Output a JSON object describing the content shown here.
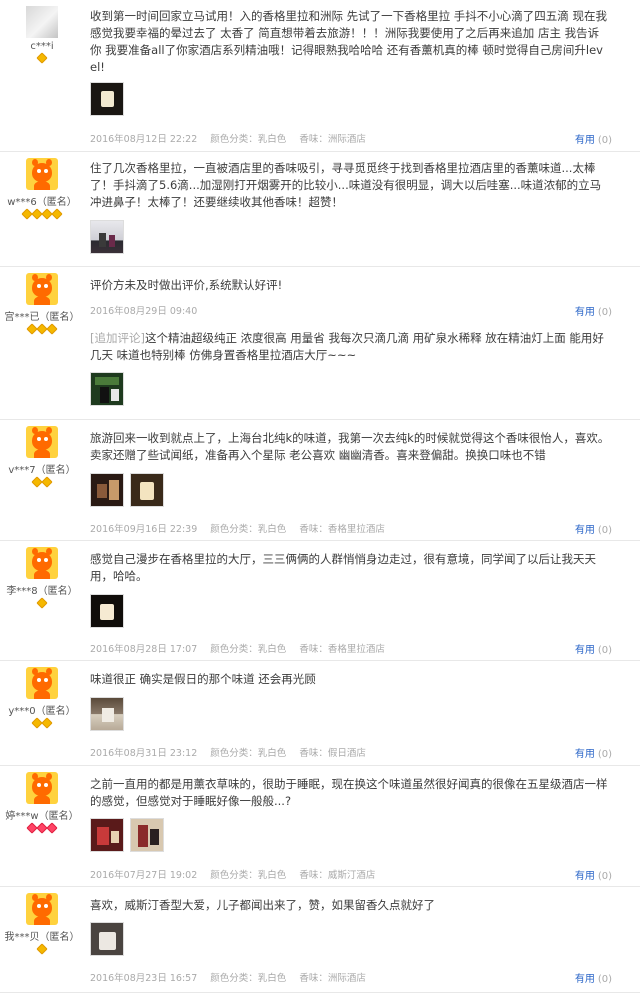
{
  "reviews": [
    {
      "user": "c***i",
      "badges": [
        "gold"
      ],
      "avatar": "gray",
      "content": "收到第一时间回家立马试用！入的香格里拉和洲际 先试了一下香格里拉 手抖不小心滴了四五滴 现在我感觉我要幸福的晕过去了 太香了 简直想带着去旅游！！！洲际我要使用了之后再来追加 店主 我告诉你 我要准备all了你家酒店系列精油哦！记得眼熟我哈哈哈 还有香薰机真的棒 顿时觉得自己房间升level!",
      "images": [
        "candle"
      ],
      "date": "2016年08月12日 22:22",
      "color_label": "颜色分类：乳白色",
      "scent_label": "香味：洲际酒店",
      "useful_label": "有用",
      "useful_count": "(0)"
    },
    {
      "user": "w***6（匿名）",
      "badges": [
        "gold",
        "gold",
        "gold",
        "gold"
      ],
      "avatar": "taobao",
      "content": "住了几次香格里拉，一直被酒店里的香味吸引，寻寻觅觅终于找到香格里拉酒店里的香薰味道...太棒了！手抖滴了5.6滴...加湿刚打开烟雾开的比较小...味道没有很明显，调大以后哇塞...味道浓郁的立马冲进鼻子！太棒了！还要继续收其他香味！超赞！",
      "images": [
        "bottles"
      ],
      "date": "",
      "color_label": "",
      "scent_label": "",
      "useful_label": "",
      "useful_count": ""
    },
    {
      "user": "宫***已（匿名）",
      "badges": [
        "gold",
        "gold",
        "gold"
      ],
      "avatar": "taobao",
      "content": "评价方未及时做出评价,系统默认好评!",
      "date": "2016年08月29日 09:40",
      "useful_label": "有用",
      "useful_count": "(0)",
      "append_label": "[追加评论]",
      "append_text": "这个精油超级纯正 浓度很高 用量省 我每次只滴几滴 用矿泉水稀释 放在精油灯上面 能用好几天 味道也特别棒 仿佛身置香格里拉酒店大厅~~~",
      "images": [
        "green"
      ]
    },
    {
      "user": "v***7（匿名）",
      "badges": [
        "gold",
        "gold"
      ],
      "avatar": "taobao",
      "content": "旅游回来一收到就点上了，上海台北纯k的味道，我第一次去纯k的时候就觉得这个香味很怡人，喜欢。卖家还赠了些试闻纸，准备再入个星际 老公喜欢 幽幽清香。喜来登偏甜。换换口味也不错",
      "images": [
        "dark",
        "candle2"
      ],
      "date": "2016年09月16日 22:39",
      "color_label": "颜色分类：乳白色",
      "scent_label": "香味：香格里拉酒店",
      "useful_label": "有用",
      "useful_count": "(0)"
    },
    {
      "user": "李***8（匿名）",
      "badges": [
        "gold"
      ],
      "avatar": "taobao",
      "content": "感觉自己漫步在香格里拉的大厅，三三俩俩的人群悄悄身边走过，很有意境，同学闻了以后让我天天用，哈哈。",
      "images": [
        "candle"
      ],
      "date": "2016年08月28日 17:07",
      "color_label": "颜色分类：乳白色",
      "scent_label": "香味：香格里拉酒店",
      "useful_label": "有用",
      "useful_count": "(0)"
    },
    {
      "user": "y***0（匿名）",
      "badges": [
        "gold",
        "gold"
      ],
      "avatar": "taobao",
      "content": "味道很正 确实是假日的那个味道 还会再光顾",
      "images": [
        "room"
      ],
      "date": "2016年08月31日 23:12",
      "color_label": "颜色分类：乳白色",
      "scent_label": "香味：假日酒店",
      "useful_label": "有用",
      "useful_count": "(0)"
    },
    {
      "user": "婷***w（匿名）",
      "badges": [
        "red",
        "red",
        "red"
      ],
      "avatar": "taobao",
      "content": "之前一直用的都是用薰衣草味的，很助于睡眠，现在换这个味道虽然很好闻真的很像在五星级酒店一样的感觉，但感觉对于睡眠好像一般般...?",
      "images": [
        "red",
        "red2"
      ],
      "date": "2016年07月27日 19:02",
      "color_label": "颜色分类：乳白色",
      "scent_label": "香味：威斯汀酒店",
      "useful_label": "有用",
      "useful_count": "(0)"
    },
    {
      "user": "我***贝（匿名）",
      "badges": [
        "gold"
      ],
      "avatar": "taobao",
      "content": "喜欢，威斯汀香型大爱，儿子都闻出来了，赞，如果留香久点就好了",
      "images": [
        "device"
      ],
      "date": "2016年08月23日 16:57",
      "color_label": "颜色分类：乳白色",
      "scent_label": "香味：洲际酒店",
      "useful_label": "有用",
      "useful_count": "(0)"
    }
  ],
  "colors": {
    "link_blue": "#2b66c8",
    "meta_gray": "#aaaaaa",
    "badge_gold": "#f5b800",
    "badge_red": "#ff4466",
    "avatar_bg": "#ffd23e",
    "avatar_face": "#ff6a00"
  }
}
